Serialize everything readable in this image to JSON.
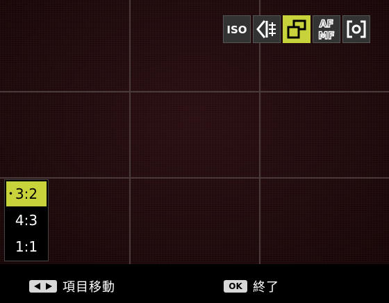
{
  "toolbar": {
    "items": [
      {
        "id": "iso",
        "label": "ISO",
        "icon": "iso-icon",
        "selected": false
      },
      {
        "id": "exposure",
        "label": "",
        "icon": "exposure-compensation-icon",
        "selected": false
      },
      {
        "id": "aspect",
        "label": "",
        "icon": "aspect-ratio-icon",
        "selected": true
      },
      {
        "id": "focus",
        "label_top": "AF",
        "label_bottom": "MF",
        "icon": "af-mf-icon",
        "selected": false
      },
      {
        "id": "metering",
        "label": "",
        "icon": "metering-icon",
        "selected": false
      }
    ]
  },
  "aspect_menu": {
    "items": [
      {
        "label": "3:2",
        "selected": true
      },
      {
        "label": "4:3",
        "selected": false
      },
      {
        "label": "1:1",
        "selected": false
      }
    ],
    "selected_marker": "•"
  },
  "footer": {
    "move_hint": "項目移動",
    "ok_badge": "OK",
    "exit_hint": "終了"
  },
  "colors": {
    "accent": "#c8d23a",
    "icon_bg": "#333333",
    "viewfinder_bg": "#200a0c",
    "grid": "#4a3a3a"
  }
}
